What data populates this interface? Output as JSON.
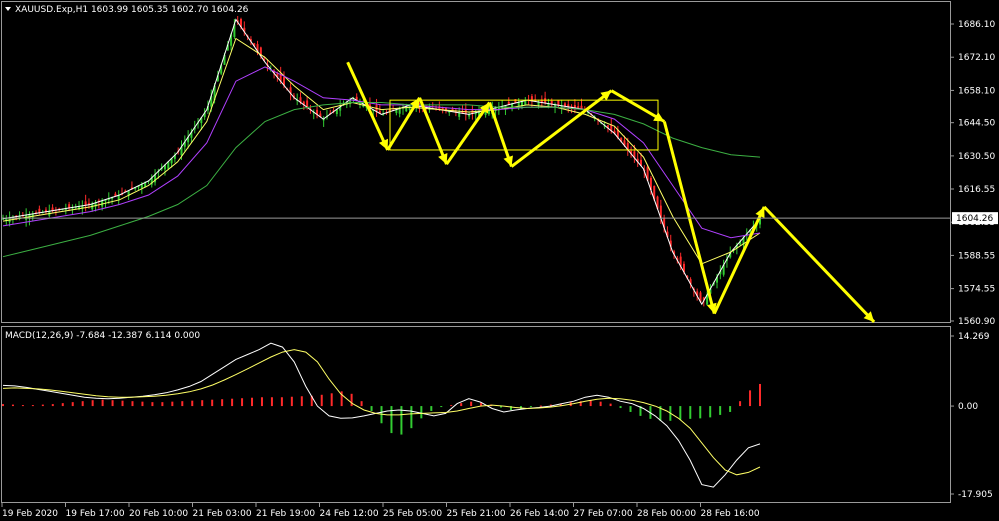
{
  "header": {
    "symbol_line": "XAUUSD.Exp,H1  1603.99 1605.35 1602.70 1604.26"
  },
  "macd": {
    "label": "MACD(12,26,9) -7.684 -12.387 6.114 0.000"
  },
  "chart_data": [
    {
      "type": "line",
      "panel": "price",
      "price_axis": {
        "ticks": [
          "1686.10",
          "1672.10",
          "1658.10",
          "1644.50",
          "1630.50",
          "1616.55",
          "1602.55",
          "1588.55",
          "1574.55",
          "1560.90"
        ],
        "ylim": [
          1560.9,
          1686.1
        ]
      },
      "current_price": "1604.26",
      "time_labels": [
        "19 Feb 2020",
        "19 Feb 17:00",
        "20 Feb 10:00",
        "21 Feb 03:00",
        "21 Feb 19:00",
        "24 Feb 12:00",
        "25 Feb 05:00",
        "25 Feb 21:00",
        "26 Feb 14:00",
        "27 Feb 07:00",
        "28 Feb 00:00",
        "28 Feb 16:00"
      ],
      "series": [
        {
          "values": [
            1604,
            1606,
            1608,
            1610,
            1614,
            1620,
            1632,
            1650,
            1688,
            1670,
            1655,
            1646,
            1655,
            1648,
            1652,
            1650,
            1648,
            1651,
            1654,
            1652,
            1650,
            1640,
            1625,
            1590,
            1568,
            1590,
            1604
          ]
        },
        {
          "values": [
            1603,
            1605,
            1607,
            1609,
            1612,
            1618,
            1628,
            1645,
            1680,
            1672,
            1660,
            1650,
            1653,
            1650,
            1651,
            1650,
            1649,
            1650,
            1652,
            1651,
            1648,
            1643,
            1630,
            1605,
            1585,
            1590,
            1598
          ]
        },
        {
          "values": [
            1601,
            1603,
            1605,
            1607,
            1610,
            1614,
            1622,
            1636,
            1662,
            1668,
            1662,
            1655,
            1654,
            1652,
            1652,
            1651,
            1650,
            1650,
            1651,
            1651,
            1650,
            1646,
            1636,
            1618,
            1600,
            1596,
            1598
          ]
        },
        {
          "values": [
            1588,
            1591,
            1594,
            1597,
            1601,
            1605,
            1610,
            1618,
            1634,
            1645,
            1650,
            1652,
            1653,
            1653,
            1652,
            1652,
            1652,
            1651,
            1651,
            1651,
            1650,
            1648,
            1644,
            1638,
            1634,
            1631,
            1630
          ]
        }
      ],
      "annotations": {
        "range_box": {
          "top": 1654,
          "bottom": 1633
        },
        "zigzag": [
          [
            0.348,
            1670
          ],
          [
            0.388,
            1633
          ],
          [
            0.42,
            1655
          ],
          [
            0.447,
            1627
          ],
          [
            0.49,
            1653
          ],
          [
            0.512,
            1626
          ],
          [
            0.612,
            1658
          ],
          [
            0.665,
            1645
          ],
          [
            0.715,
            1564
          ],
          [
            0.765,
            1609
          ],
          [
            0.875,
            1560.5
          ]
        ]
      },
      "up_color": "#32cd32",
      "down_color": "#ff2a2a",
      "line_color": "#ffff00"
    },
    {
      "type": "bar",
      "panel": "macd",
      "axis_ticks": [
        "14.269",
        "0.00",
        "-17.905"
      ],
      "ylim": [
        -17.905,
        14.269
      ],
      "series": [
        {
          "name": "histogram",
          "values": [
            0.4,
            0.3,
            0.2,
            0.2,
            0.3,
            0.4,
            0.6,
            0.8,
            1.0,
            1.2,
            1.3,
            1.2,
            1.1,
            1.0,
            0.9,
            0.8,
            0.8,
            0.9,
            1.0,
            1.1,
            1.2,
            1.3,
            1.4,
            1.5,
            1.6,
            1.7,
            1.8,
            1.8,
            1.8,
            1.9,
            2.0,
            2.1,
            2.3,
            2.6,
            3.0,
            2.5,
            1.0,
            -1.0,
            -3.5,
            -5.5,
            -5.8,
            -4.5,
            -2.5,
            -1.0,
            -0.2,
            0.2,
            0.6,
            0.9,
            0.7,
            0.3,
            -0.3,
            -0.8,
            -0.6,
            -0.2,
            0.1,
            0.3,
            0.5,
            0.8,
            1.0,
            1.2,
            0.9,
            0.5,
            -0.4,
            -1.2,
            -2.0,
            -2.6,
            -3.0,
            -3.0,
            -2.8,
            -2.6,
            -2.5,
            -2.3,
            -1.8,
            -1.2,
            1.0,
            3.2,
            4.5
          ]
        },
        {
          "name": "macd",
          "values": [
            4.2,
            4.1,
            3.8,
            3.4,
            3.0,
            2.6,
            2.2,
            1.8,
            1.6,
            1.5,
            1.6,
            1.8,
            2.0,
            2.3,
            2.7,
            3.3,
            4.0,
            5.0,
            6.5,
            8.0,
            9.5,
            10.5,
            11.5,
            12.8,
            12.0,
            9.0,
            4.0,
            0.0,
            -2.0,
            -2.5,
            -2.4,
            -2.0,
            -1.5,
            -1.0,
            -0.8,
            -1.0,
            -1.5,
            -2.0,
            -1.5,
            0.5,
            1.5,
            0.8,
            -0.5,
            -1.2,
            -0.8,
            -0.5,
            -0.3,
            0.0,
            0.5,
            1.0,
            1.8,
            2.2,
            1.8,
            1.0,
            0.5,
            -0.5,
            -2.0,
            -4.0,
            -7.0,
            -11.0,
            -16.0,
            -16.5,
            -14.0,
            -11.0,
            -8.5,
            -7.7
          ]
        },
        {
          "name": "signal",
          "values": [
            3.6,
            3.7,
            3.6,
            3.5,
            3.3,
            3.0,
            2.7,
            2.4,
            2.1,
            1.9,
            1.8,
            1.8,
            1.9,
            2.0,
            2.2,
            2.5,
            2.9,
            3.5,
            4.3,
            5.3,
            6.4,
            7.6,
            8.8,
            10.0,
            11.0,
            11.5,
            11.0,
            9.0,
            5.5,
            2.5,
            0.5,
            -0.8,
            -1.5,
            -1.8,
            -1.8,
            -1.6,
            -1.5,
            -1.4,
            -1.3,
            -1.0,
            -0.5,
            0.0,
            0.2,
            0.0,
            -0.3,
            -0.5,
            -0.4,
            -0.2,
            0.1,
            0.5,
            1.0,
            1.4,
            1.6,
            1.5,
            1.2,
            0.7,
            0.0,
            -1.0,
            -2.5,
            -4.5,
            -7.5,
            -10.5,
            -13.0,
            -14.0,
            -13.5,
            -12.4
          ]
        }
      ],
      "up_color": "#ff2a2a",
      "down_color": "#32cd32"
    }
  ]
}
